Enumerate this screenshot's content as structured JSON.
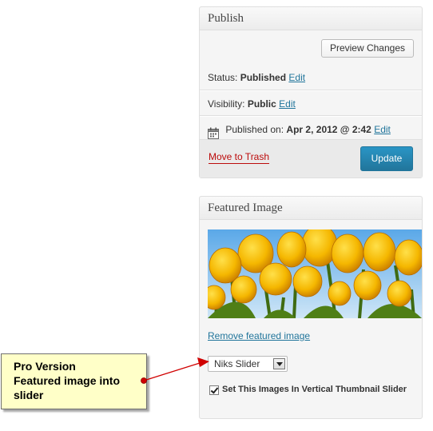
{
  "publish": {
    "title": "Publish",
    "preview_label": "Preview Changes",
    "status_label": "Status:",
    "status_value": "Published",
    "visibility_label": "Visibility:",
    "visibility_value": "Public",
    "published_label": "Published on:",
    "published_value": "Apr 2, 2012 @ 2:42",
    "edit_label": "Edit",
    "trash_label": "Move to Trash",
    "update_label": "Update"
  },
  "featured": {
    "title": "Featured Image",
    "remove_label": "Remove featured image",
    "select_value": "Niks Slider",
    "checkbox_checked": true,
    "checkbox_label": "Set This Images In Vertical Thumbnail Slider"
  },
  "callout": {
    "lines": [
      "Pro Version",
      "Featured image into",
      "slider"
    ]
  },
  "colors": {
    "link": "#21759b",
    "trash": "#bc0b0b",
    "update_button": "#21759b",
    "callout_bg": "#ffffc8",
    "arrow": "#d00000"
  }
}
